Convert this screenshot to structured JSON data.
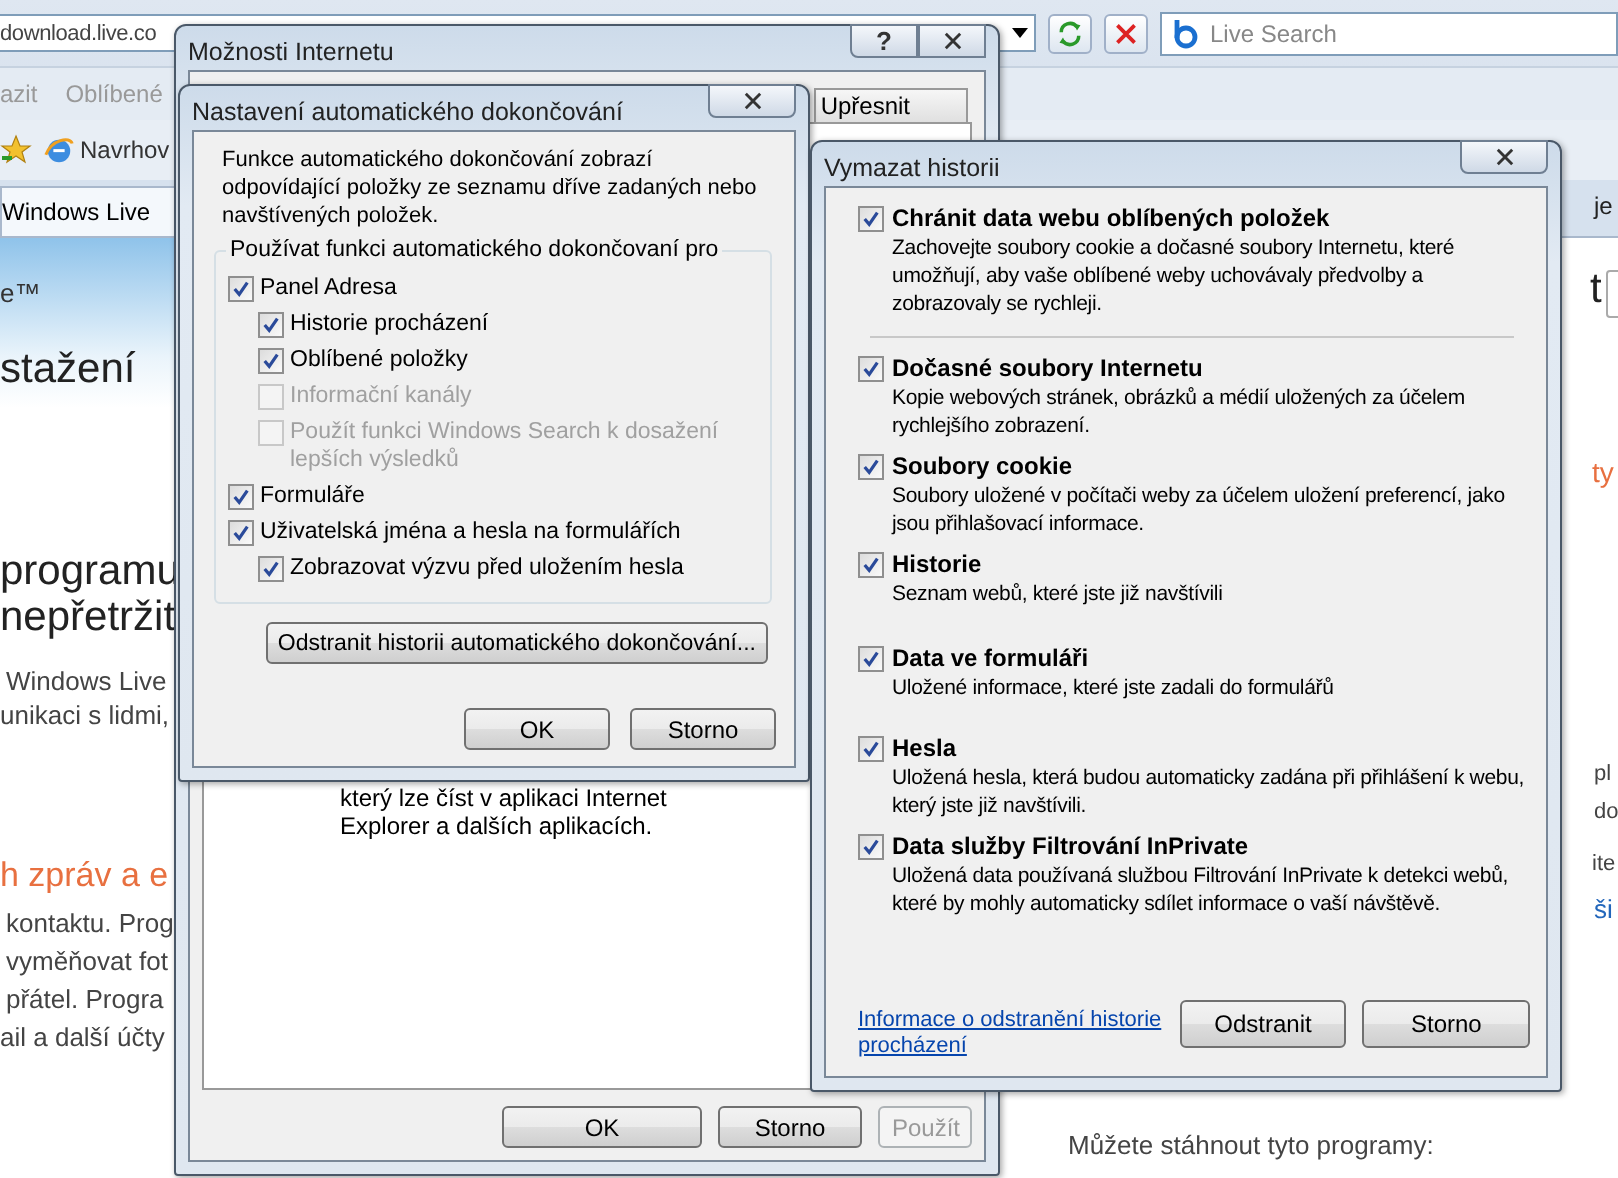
{
  "browser": {
    "address": "download.live.co",
    "search": {
      "placeholder": "Live Search"
    },
    "menu": [
      "azit",
      "Oblíbené"
    ],
    "favorites": [
      "Navrhov"
    ],
    "tab": "Windows Live",
    "page_texts": [
      {
        "kind": "logo",
        "text": "e™"
      },
      {
        "kind": "title",
        "text": "stažení"
      },
      {
        "kind": "title",
        "text": "programu"
      },
      {
        "kind": "title",
        "text": "nepřetržit"
      },
      {
        "kind": "text",
        "text": "Windows Live"
      },
      {
        "kind": "text",
        "text": "unikaci s lidmi,"
      },
      {
        "kind": "accent",
        "text": "h zpráv a e"
      },
      {
        "kind": "text",
        "text": "kontaktu. Prog"
      },
      {
        "kind": "text",
        "text": "vyměňovat fot"
      },
      {
        "kind": "text",
        "text": "přátel. Progra"
      },
      {
        "kind": "text",
        "text": "ail a další účty"
      },
      {
        "kind": "small",
        "text": "je"
      },
      {
        "kind": "title",
        "text": "t"
      },
      {
        "kind": "accent",
        "text": "ty"
      },
      {
        "kind": "edge",
        "text": "pl"
      },
      {
        "kind": "edge",
        "text": "do"
      },
      {
        "kind": "edge",
        "text": "ite"
      },
      {
        "kind": "link",
        "text": "ši"
      },
      {
        "kind": "text",
        "text": "Můžete stáhnout tyto programy:"
      }
    ]
  },
  "options_window": {
    "title": "Možnosti Internetu",
    "help": "?",
    "tabs": [
      {
        "label": "Upřesnit",
        "selected": false
      }
    ],
    "panel_text": [
      "který lze číst v aplikaci Internet",
      "Explorer a dalších aplikacích."
    ],
    "buttons": [
      {
        "label": "OK",
        "disabled": false
      },
      {
        "label": "Storno",
        "disabled": false
      },
      {
        "label": "Použít",
        "disabled": true
      }
    ]
  },
  "autocomplete_dialog": {
    "title": "Nastavení automatického dokončování",
    "intro": "Funkce automatického dokončování zobrazí odpovídající položky ze seznamu dříve zadaných nebo navštívených položek.",
    "group": "Používat funkci automatického dokončovaní pro",
    "options": [
      {
        "label": "Panel Adresa",
        "checked": true,
        "disabled": false,
        "children": [
          {
            "label": "Historie procházení",
            "checked": true,
            "disabled": false
          },
          {
            "label": "Oblíbené položky",
            "checked": true,
            "disabled": false
          },
          {
            "label": "Informační kanály",
            "checked": false,
            "disabled": true
          },
          {
            "label": "Použít funkci Windows Search k dosažení lepších výsledků",
            "checked": false,
            "disabled": true
          }
        ]
      },
      {
        "label": "Formuláře",
        "checked": true,
        "disabled": false
      },
      {
        "label": "Uživatelská jména a hesla na formulářích",
        "checked": true,
        "disabled": false,
        "children": [
          {
            "label": "Zobrazovat výzvu před uložením hesla",
            "checked": true,
            "disabled": false
          }
        ]
      }
    ],
    "clear_button": "Odstranit historii automatického dokončování...",
    "buttons": [
      "OK",
      "Storno"
    ]
  },
  "history_dialog": {
    "title": "Vymazat historii",
    "sections": [
      [
        {
          "label": "Chránit data webu oblíbených položek",
          "description": "Zachovejte soubory cookie a dočasné soubory Internetu, které umožňují, aby vaše oblíbené weby uchovávaly předvolby a zobrazovaly se rychleji.",
          "checked": true
        }
      ],
      [
        {
          "label": "Dočasné soubory Internetu",
          "description": "Kopie webových stránek, obrázků a médií uložených za účelem rychlejšího zobrazení.",
          "checked": true
        },
        {
          "label": "Soubory cookie",
          "description": "Soubory uložené v počítači weby za účelem uložení preferencí, jako jsou přihlašovací informace.",
          "checked": true
        },
        {
          "label": "Historie",
          "description": "Seznam webů, které jste již navštívili",
          "checked": true
        },
        {
          "label": "Data ve formuláři",
          "description": "Uložené informace, které jste zadali do formulářů",
          "checked": true
        },
        {
          "label": "Hesla",
          "description": "Uložená hesla, která budou automaticky zadána při přihlášení k webu, který jste již navštívili.",
          "checked": true
        },
        {
          "label": "Data služby Filtrování InPrivate",
          "description": "Uložená data používaná službou Filtrování InPrivate k detekci webů, které by mohly automaticky sdílet informace o vaší návštěvě.",
          "checked": true
        }
      ]
    ],
    "link": "Informace o odstranění historie procházení",
    "buttons": [
      "Odstranit",
      "Storno"
    ]
  }
}
